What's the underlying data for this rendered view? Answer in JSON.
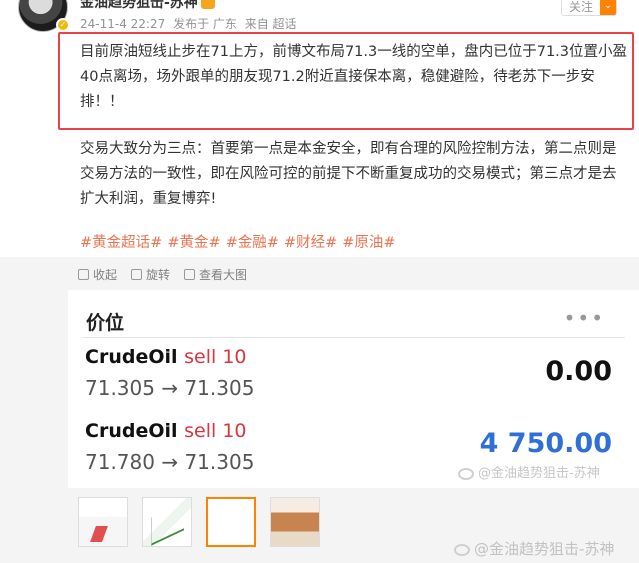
{
  "post": {
    "author": "金油趋势狙击-苏神",
    "meta": {
      "datetime": "24-11-4 22:27",
      "published": "发布于 广东",
      "source": "来自 超话"
    },
    "follow_label": "关注",
    "para1": "目前原油短线止步在71上方，前博文布局71.3一线的空单，盘内已位于71.3位置小盈40点离场，场外跟单的朋友现71.2附近直接保本离，稳健避险，待老苏下一步安排！！",
    "para2": "交易大致分为三点：首要第一点是本金安全，即有合理的风险控制方法，第二点则是交易方法的一致性，即在风险可控的前提下不断重复成功的交易模式；第三点才是去扩大利润，重复博弈!",
    "tags": [
      "#黄金超话#",
      "#黄金#",
      "#金融#",
      "#财经#",
      "#原油#"
    ]
  },
  "actions": {
    "collapse": "收起",
    "rotate": "旋转",
    "view_large": "查看大图"
  },
  "card": {
    "title": "价位",
    "positions": [
      {
        "symbol": "CrudeOil",
        "side": "sell 10",
        "price_range": "71.305 → 71.305",
        "profit": "0.00",
        "profit_color": "#111111"
      },
      {
        "symbol": "CrudeOil",
        "side": "sell 10",
        "price_range": "71.780 → 71.305",
        "profit": "4 750.00",
        "profit_color": "#2f6fd6"
      }
    ]
  },
  "watermarks": {
    "inner": "@金油趋势狙击-苏神",
    "outer": "@金油趋势狙击-苏神"
  },
  "colors": {
    "accent": "#ff8200",
    "highlight_border": "#e8434b",
    "tag": "#eb7350",
    "sell": "#d9363e"
  }
}
